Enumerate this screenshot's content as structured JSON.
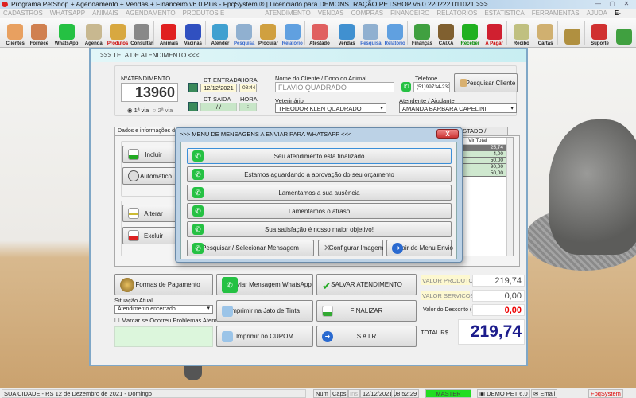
{
  "window": {
    "title": "Programa PetShop + Agendamento + Vendas + Financeiro v6.0 Plus - FpqSystem ® | Licenciado para  DEMONSTRAÇÃO PETSHOP v6.0 220222 011021 >>>",
    "min": "—",
    "max": "▢",
    "close": "✕"
  },
  "menu": [
    "CADASTROS",
    "WHATSAPP",
    "ANIMAIS",
    "AGENDAMENTO",
    "PRODUTOS E SERVIÇOS",
    "ATENDIMENTO",
    "VENDAS",
    "COMPRAS",
    "FINANCEIRO",
    "RELATÓRIOS",
    "ESTATISTICA",
    "FERRAMENTAS",
    "AJUDA"
  ],
  "menu_email": "E-MAIL",
  "toolbar": [
    {
      "label": "Clientes",
      "color": "#e8a060"
    },
    {
      "label": "Fornece",
      "color": "#d08050"
    },
    {
      "label": "WhatsApp",
      "color": "#25c143"
    },
    {
      "label": "Agenda",
      "color": "#c8b890"
    },
    {
      "label": "Produtos",
      "color": "#d8a840"
    },
    {
      "label": "Consultar",
      "color": "#888888"
    },
    {
      "label": "Animais",
      "color": "#e02020"
    },
    {
      "label": "Vacinas",
      "color": "#3050c0"
    },
    {
      "label": "Atender",
      "color": "#40a0d0"
    },
    {
      "label": "Pesquisa",
      "color": "#90b0d0"
    },
    {
      "label": "Procurar",
      "color": "#d0a040"
    },
    {
      "label": "Relatório",
      "color": "#60a0e0"
    },
    {
      "label": "Atestado",
      "color": "#e06060"
    },
    {
      "label": "Vendas",
      "color": "#4090d0"
    },
    {
      "label": "Pesquisa",
      "color": "#90b0d0"
    },
    {
      "label": "Relatório",
      "color": "#60a0e0"
    },
    {
      "label": "Finanças",
      "color": "#40a040"
    },
    {
      "label": "CAIXA",
      "color": "#806030"
    },
    {
      "label": "Receber",
      "color": "#20b020"
    },
    {
      "label": "A Pagar",
      "color": "#d02030"
    },
    {
      "label": "Recibo",
      "color": "#c0c080"
    },
    {
      "label": "Cartas",
      "color": "#d0b070"
    },
    {
      "label": "",
      "color": "#b09040"
    },
    {
      "label": "Suporte",
      "color": "#d03030"
    },
    {
      "label": "",
      "color": "#40a040"
    }
  ],
  "form": {
    "header": ">>>   TELA DE ATENDIMENTO   <<<",
    "num_label": "NºATENDIMENTO",
    "num_value": "13960",
    "via1": "1ª via",
    "via2": "2ª via",
    "dt_entrada_label": "DT ENTRADA",
    "dt_entrada": "12/12/2021",
    "hora_label": "HORA",
    "hora_entrada": "08:44",
    "dt_saida_label": "DT SAIDA",
    "dt_saida": "/ /",
    "hora_saida": ":",
    "cliente_label": "Nome do Cliente / Dono do Animal",
    "cliente": "FLAVIO QUADRADO",
    "telefone_label": "Telefone",
    "telefone": "(51)99734-2390",
    "pesquisar_cliente": "Pesquisar Cliente",
    "vet_label": "Veterinário",
    "vet": "THEODOR KLEN QUADRADO",
    "atendente_label": "Atendente / Ajudante",
    "atendente": "AMANDA BARBARA CAPELINI"
  },
  "tabs": {
    "tab1": "Dados e informações do A",
    "tab2": "STADO / OUTROS"
  },
  "side_buttons": {
    "incluir": "Incluir",
    "automatico": "Automático",
    "alterar": "Alterar",
    "excluir": "Excluir"
  },
  "grid": {
    "header": "Vlr Total",
    "values": [
      "25,74",
      "4,00",
      "50,00",
      "90,00",
      "50,00"
    ]
  },
  "dialog": {
    "title": ">>> MENU DE MENSAGENS A ENVIAR PARA WHATSAPP <<<",
    "close": "X",
    "messages": [
      "Seu atendimento está finalizado",
      "Estamos aguardando a aprovação do seu orçamento",
      "Lamentamos a sua ausência",
      "Lamentamos o atraso",
      "Sua satisfação é nosso maior objetivo!"
    ],
    "search": "Pesquisar / Selecionar Mensagem",
    "config": "Configurar Imagem",
    "exit": "Sair do Menu Envio"
  },
  "bottom": {
    "formas": "Formas de Pagamento",
    "whatsapp": "Enviar Mensagem WhatsApp",
    "salvar": "SALVAR  ATENDIMENTO",
    "situacao_label": "Situação Atual",
    "situacao": "Atendimento encerrado",
    "problemas": "Marcar se Ocorreu Problemas Atendimento",
    "jato": "Imprimir na Jato de Tinta",
    "finalizar": "FINALIZAR",
    "cupom": "Imprimir no CUPOM",
    "sair": "S A I R"
  },
  "totals": {
    "produtos_label": "VALOR PRODUTOS",
    "produtos": "219,74",
    "servicos_label": "VALOR SERVICOS",
    "servicos": "0,00",
    "desconto_label": "Valor do Desconto ( - )",
    "desconto": "0,00",
    "total_label": "TOTAL R$",
    "total": "219,74"
  },
  "statusbar": {
    "city": "SUA CIDADE - RS 12 de Dezembro de 2021 - Domingo",
    "num": "Num",
    "caps": "Caps",
    "ins": "Ins",
    "date": "12/12/2021",
    "time": "08:52:29",
    "user": "MASTER",
    "db": "DEMO PET 6.0",
    "email": "Email",
    "brand": "FpqSystem"
  }
}
